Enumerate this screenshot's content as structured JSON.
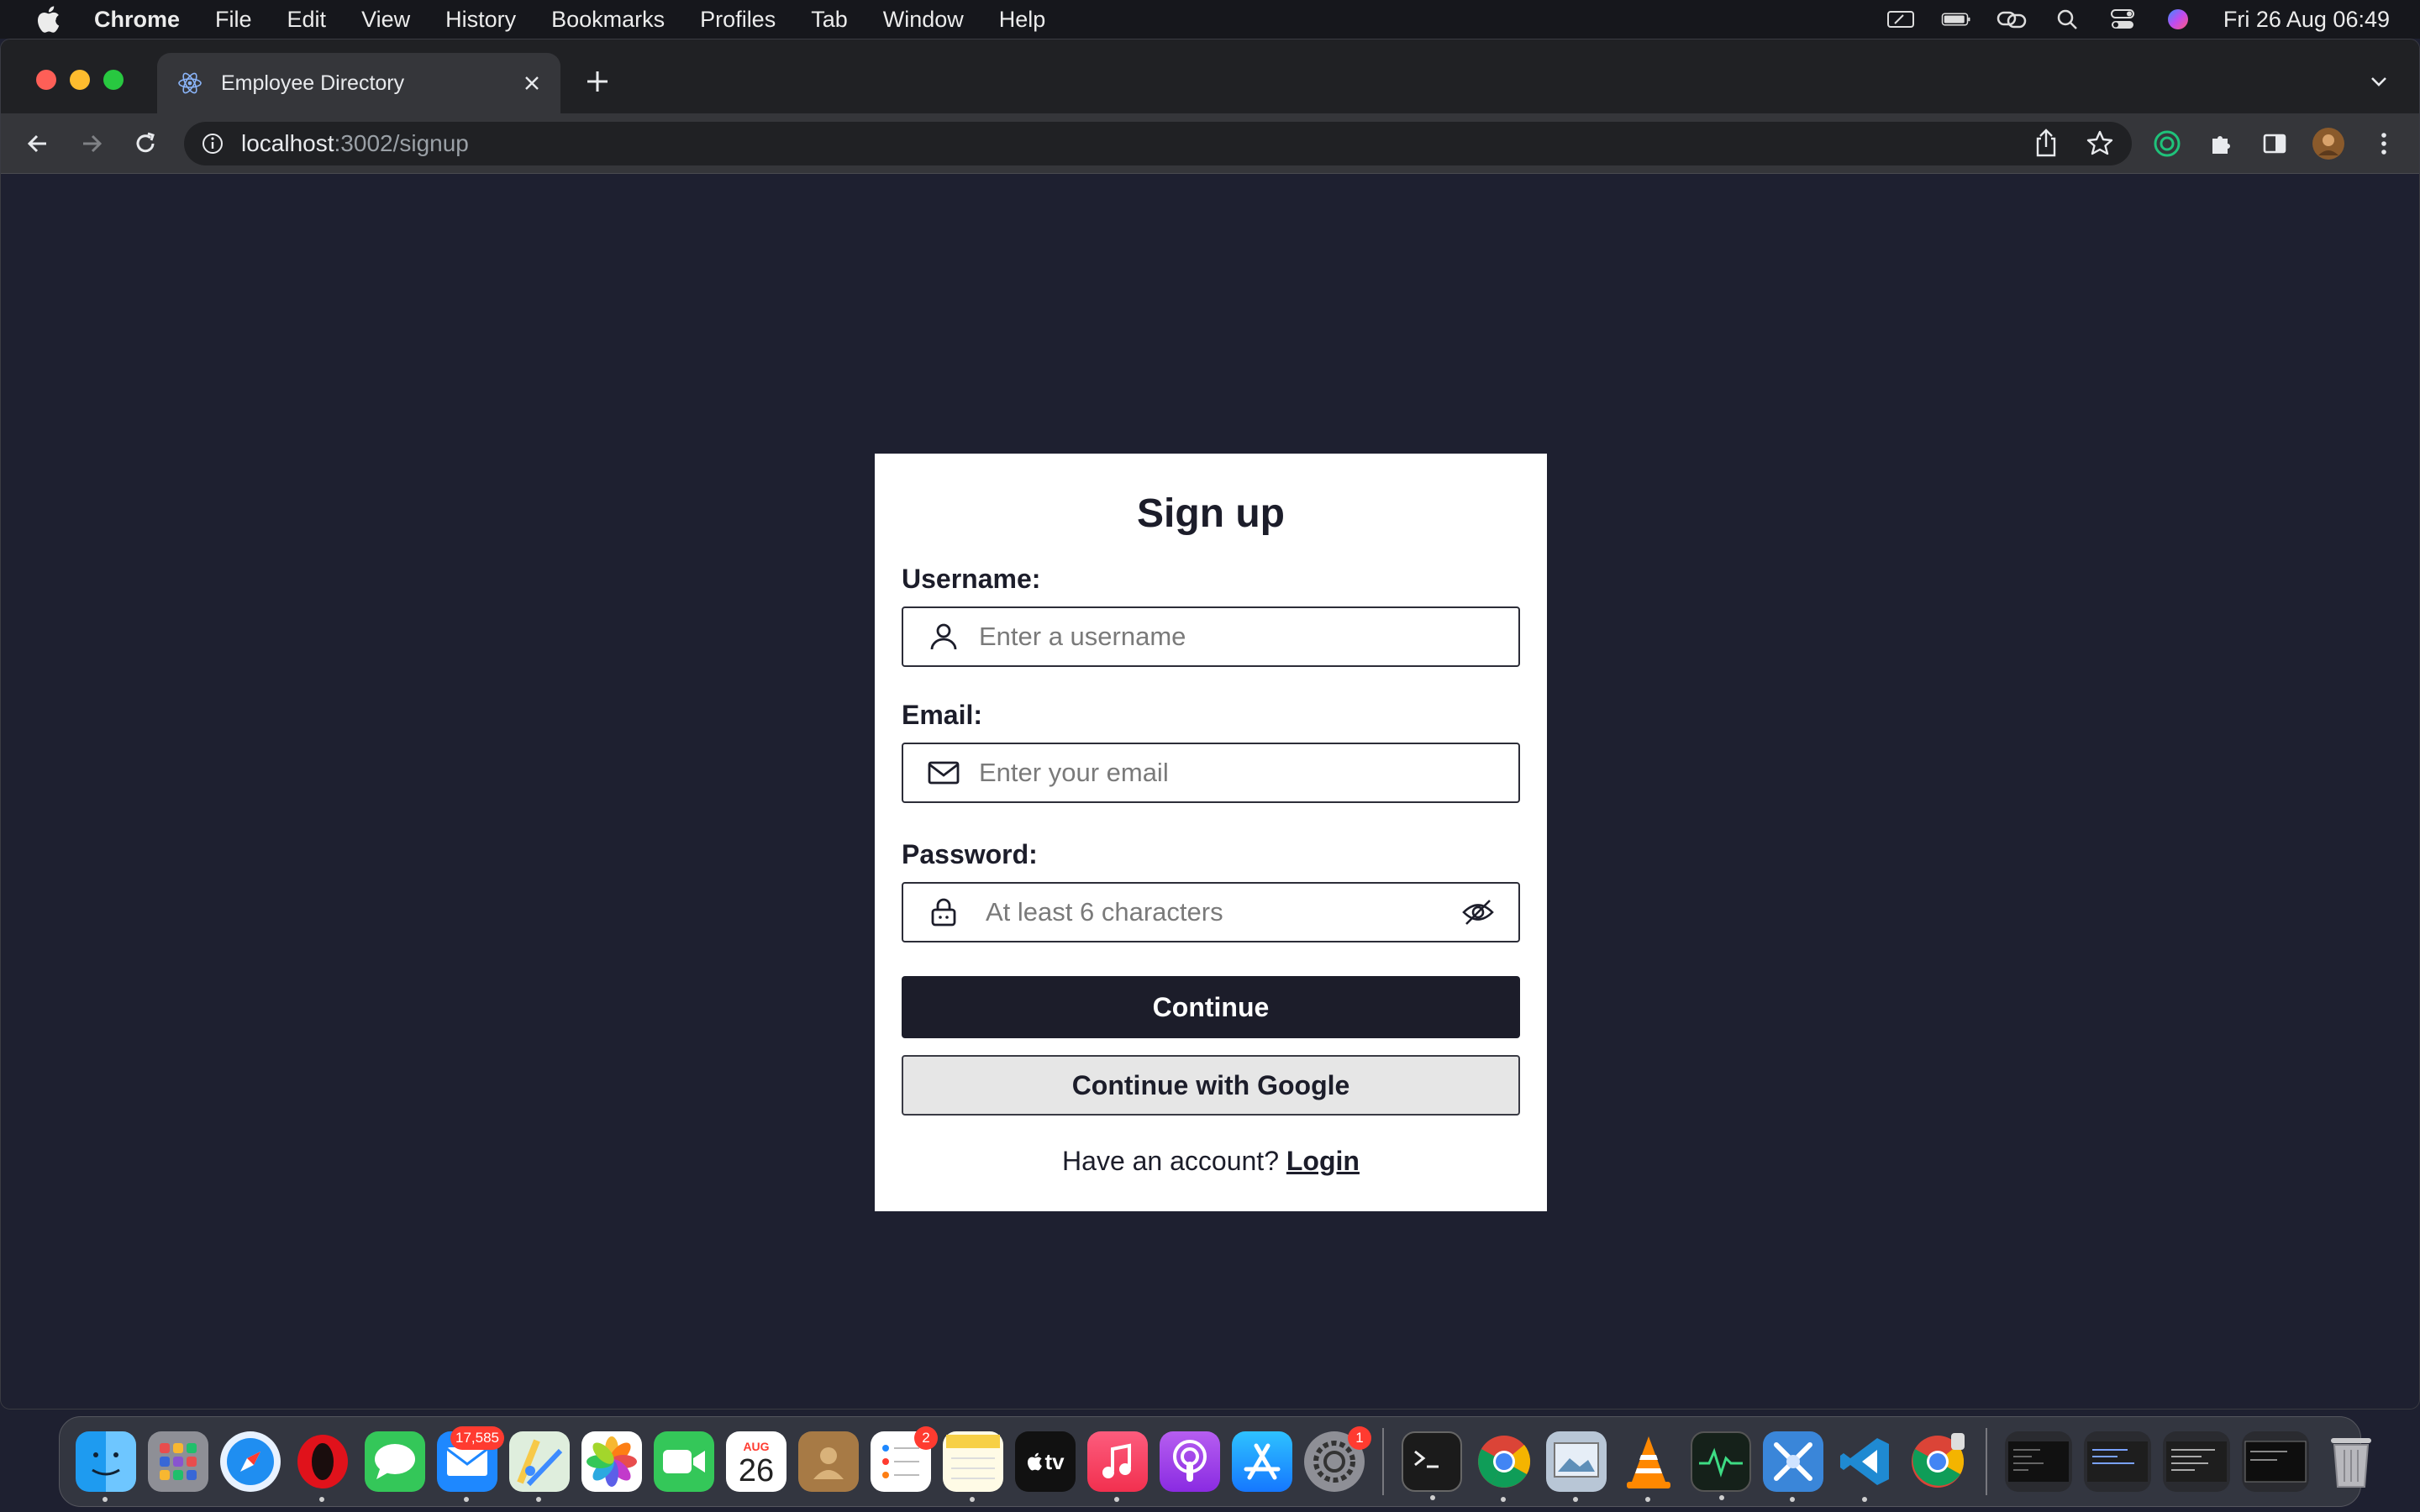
{
  "menubar": {
    "app": "Chrome",
    "items": [
      "File",
      "Edit",
      "View",
      "History",
      "Bookmarks",
      "Profiles",
      "Tab",
      "Window",
      "Help"
    ],
    "clock": "Fri 26 Aug  06:49"
  },
  "browser": {
    "tab_title": "Employee Directory",
    "url_host": "localhost",
    "url_path": ":3002/signup"
  },
  "signup": {
    "title": "Sign up",
    "username_label": "Username:",
    "username_placeholder": "Enter a username",
    "email_label": "Email:",
    "email_placeholder": "Enter your email",
    "password_label": "Password:",
    "password_placeholder": "At least 6 characters",
    "continue_label": "Continue",
    "google_label": "Continue with Google",
    "have_account": "Have an account?",
    "login_link": "Login"
  },
  "dock": {
    "mail_badge": "17,585",
    "calendar_month": "AUG",
    "calendar_day": "26",
    "reminders_badge": "2",
    "settings_badge": "1",
    "tv_label": "tv"
  },
  "colors": {
    "page_bg": "#1e2030",
    "primary_button": "#1c1d2a",
    "secondary_button": "#e6e6e6"
  }
}
